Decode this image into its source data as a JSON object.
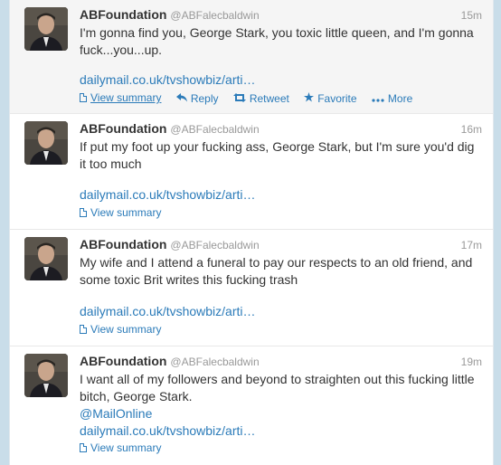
{
  "tweets": [
    {
      "fullname": "ABFoundation",
      "username": "@ABFalecbaldwin",
      "time": "15m",
      "text": "I'm gonna find you, George Stark, you toxic little queen, and I'm gonna fuck...you...up.",
      "mention": "",
      "link": "dailymail.co.uk/tvshowbiz/arti…",
      "summary": "View summary",
      "reply": "Reply",
      "retweet": "Retweet",
      "favorite": "Favorite",
      "more": "More"
    },
    {
      "fullname": "ABFoundation",
      "username": "@ABFalecbaldwin",
      "time": "16m",
      "text": "If put my foot up your fucking ass, George Stark, but I'm sure you'd dig it too much",
      "mention": "",
      "link": "dailymail.co.uk/tvshowbiz/arti…",
      "summary": "View summary"
    },
    {
      "fullname": "ABFoundation",
      "username": "@ABFalecbaldwin",
      "time": "17m",
      "text": "My wife and I attend a funeral to pay our respects to an old friend, and some toxic Brit writes this fucking trash",
      "mention": "",
      "link": "dailymail.co.uk/tvshowbiz/arti…",
      "summary": "View summary"
    },
    {
      "fullname": "ABFoundation",
      "username": "@ABFalecbaldwin",
      "time": "19m",
      "text": "I want all of my followers and beyond to straighten out this fucking little bitch, George Stark.",
      "mention": "@MailOnline",
      "link": "dailymail.co.uk/tvshowbiz/arti…",
      "summary": "View summary"
    }
  ],
  "icons": {
    "reply": "reply-arrow-icon",
    "retweet": "retweet-icon",
    "favorite": "star-icon",
    "more": "more-dots-icon",
    "summary": "document-icon"
  },
  "colors": {
    "link": "#2b7bb9",
    "name": "#333333",
    "meta": "#999999",
    "background": "#c9dde9"
  }
}
